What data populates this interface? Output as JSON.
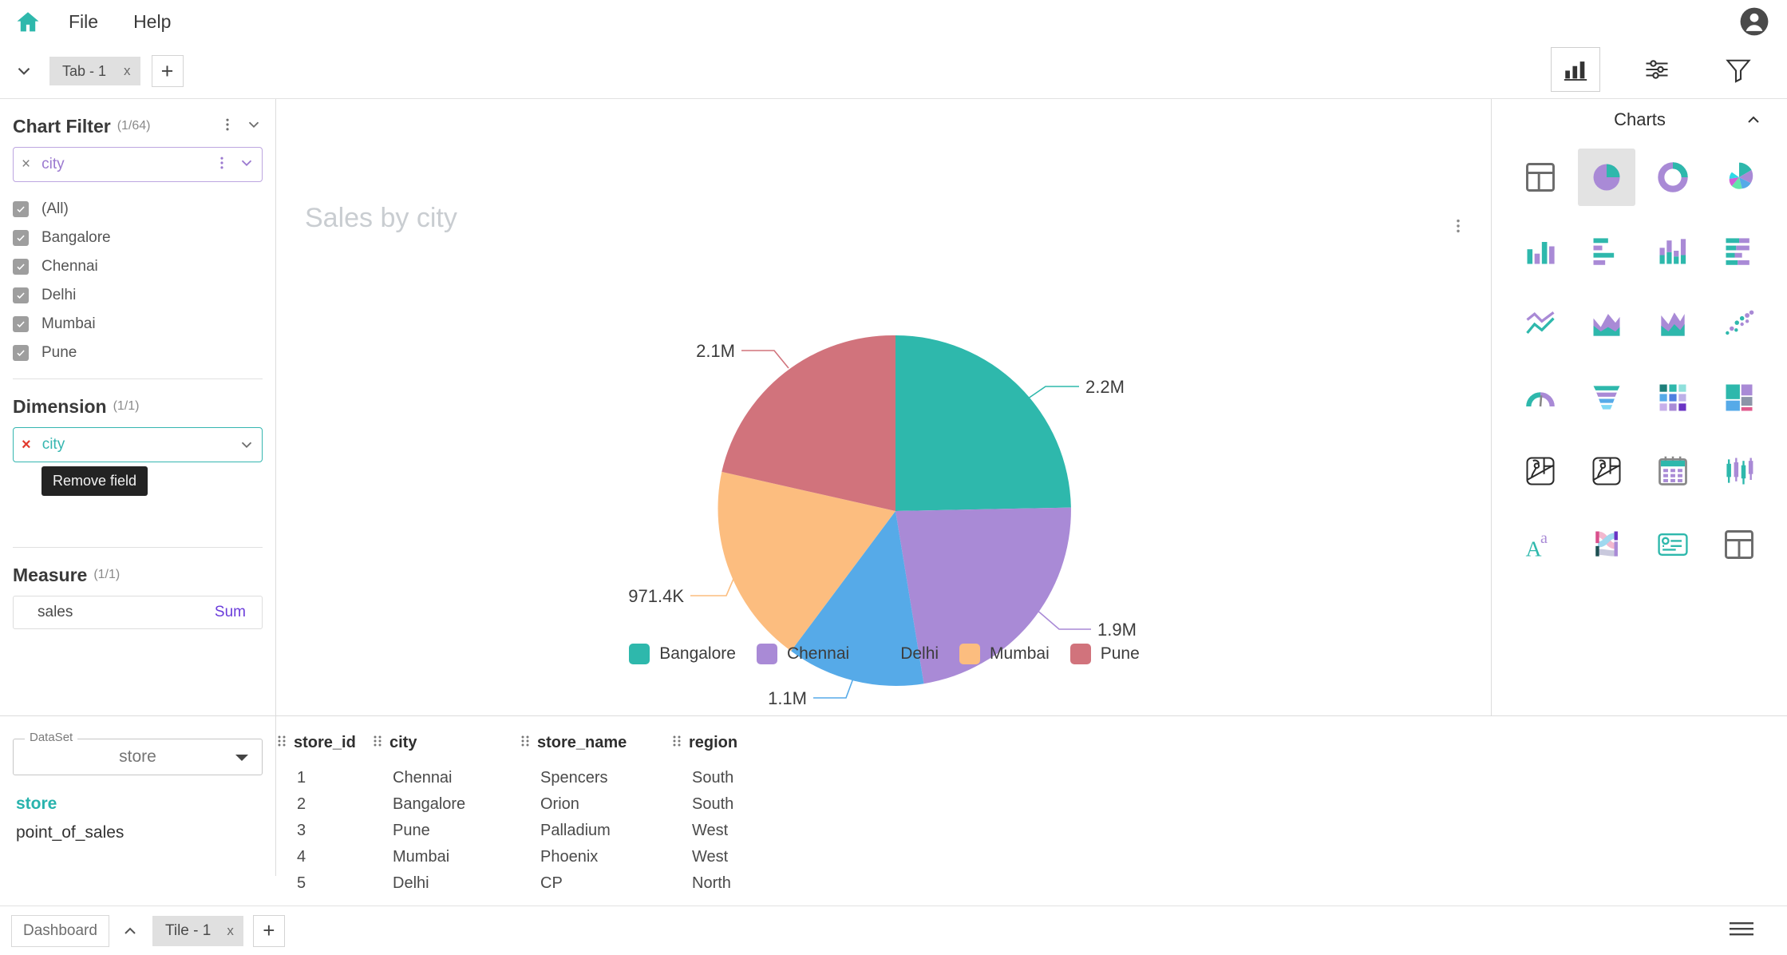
{
  "app": {
    "menu": [
      {
        "label": "File",
        "name": "menu-file"
      },
      {
        "label": "Help",
        "name": "menu-help"
      }
    ],
    "home_icon": "home-icon",
    "avatar_icon": "account-avatar-icon"
  },
  "tabs": {
    "collapse_icon": "chevron-down-icon",
    "items": [
      {
        "label": "Tab - 1",
        "close": "x"
      }
    ],
    "add_label": "+"
  },
  "toolbar": {
    "chart_icon": "bar-chart-icon",
    "settings_icon": "sliders-settings-icon",
    "filter_icon": "funnel-filter-icon"
  },
  "chart_filter": {
    "title": "Chart Filter",
    "count": "(1/64)",
    "kebab_icon": "more-vertical-icon",
    "chevron_icon": "chevron-down-icon",
    "field": {
      "remove": "×",
      "label": "city",
      "kebab_icon": "more-vertical-icon",
      "chevron_icon": "chevron-down-icon"
    },
    "options": [
      "(All)",
      "Bangalore",
      "Chennai",
      "Delhi",
      "Mumbai",
      "Pune"
    ]
  },
  "dimension": {
    "title": "Dimension",
    "count": "(1/1)",
    "field": {
      "remove": "×",
      "label": "city",
      "chevron_icon": "chevron-down-icon"
    },
    "tooltip": "Remove field"
  },
  "measure": {
    "title": "Measure",
    "count": "(1/1)",
    "field": {
      "name": "sales",
      "aggregation": "Sum"
    }
  },
  "chart_panel": {
    "title": "Sales by city",
    "kebab_icon": "more-vertical-icon"
  },
  "chart_data": {
    "type": "pie",
    "title": "Sales by city",
    "categories": [
      "Bangalore",
      "Chennai",
      "Delhi",
      "Mumbai",
      "Pune"
    ],
    "values": [
      2200000,
      1900000,
      1100000,
      971400,
      2100000
    ],
    "labels": [
      "2.2M",
      "1.9M",
      "1.1M",
      "971.4K",
      "2.1M"
    ],
    "colors": [
      "#2eb8ac",
      "#a98ad6",
      "#56aae8",
      "#fcbd7f",
      "#d1737c"
    ],
    "legend_position": "bottom",
    "xlabel": "",
    "ylabel": ""
  },
  "charts_panel": {
    "title": "Charts",
    "collapse_icon": "chevron-up-icon",
    "icons": [
      {
        "name": "table-chart-icon",
        "selected": false
      },
      {
        "name": "pie-chart-icon",
        "selected": true
      },
      {
        "name": "donut-chart-icon",
        "selected": false
      },
      {
        "name": "rose-chart-icon",
        "selected": false
      },
      {
        "name": "column-chart-icon",
        "selected": false
      },
      {
        "name": "bar-chart-icon",
        "selected": false
      },
      {
        "name": "stacked-column-chart-icon",
        "selected": false
      },
      {
        "name": "stacked-bar-chart-icon",
        "selected": false
      },
      {
        "name": "line-chart-icon",
        "selected": false
      },
      {
        "name": "area-chart-icon",
        "selected": false
      },
      {
        "name": "stacked-area-chart-icon",
        "selected": false
      },
      {
        "name": "scatter-chart-icon",
        "selected": false
      },
      {
        "name": "gauge-chart-icon",
        "selected": false
      },
      {
        "name": "funnel-chart-icon",
        "selected": false
      },
      {
        "name": "heatmap-chart-icon",
        "selected": false
      },
      {
        "name": "treemap-chart-icon",
        "selected": false
      },
      {
        "name": "map-chart-icon",
        "selected": false
      },
      {
        "name": "filled-map-chart-icon",
        "selected": false
      },
      {
        "name": "calendar-chart-icon",
        "selected": false
      },
      {
        "name": "candlestick-chart-icon",
        "selected": false
      },
      {
        "name": "word-cloud-icon",
        "selected": false
      },
      {
        "name": "sankey-chart-icon",
        "selected": false
      },
      {
        "name": "kpi-card-icon",
        "selected": false
      },
      {
        "name": "pivot-table-icon",
        "selected": false
      }
    ]
  },
  "dataset": {
    "legend": "DataSet",
    "selected": "store",
    "caret_icon": "caret-down-icon",
    "items": [
      {
        "label": "store",
        "active": true
      },
      {
        "label": "point_of_sales",
        "active": false
      }
    ]
  },
  "data_grid": {
    "columns": [
      "store_id",
      "city",
      "store_name",
      "region"
    ],
    "rows": [
      [
        "1",
        "Chennai",
        "Spencers",
        "South"
      ],
      [
        "2",
        "Bangalore",
        "Orion",
        "South"
      ],
      [
        "3",
        "Pune",
        "Palladium",
        "West"
      ],
      [
        "4",
        "Mumbai",
        "Phoenix",
        "West"
      ],
      [
        "5",
        "Delhi",
        "CP",
        "North"
      ]
    ]
  },
  "bottom_bar": {
    "dashboard_label": "Dashboard",
    "collapse_icon": "chevron-up-icon",
    "tiles": [
      {
        "label": "Tile - 1",
        "close": "x"
      }
    ],
    "add_label": "+",
    "menu_icon": "hamburger-menu-icon"
  },
  "colors": {
    "brand_teal": "#2eb8ac",
    "accent_purple": "#9b79d0",
    "danger_red": "#e23b2e"
  }
}
